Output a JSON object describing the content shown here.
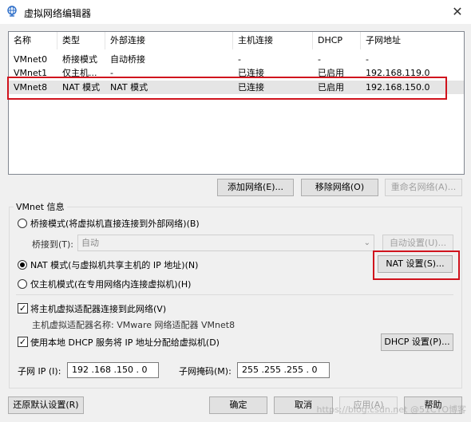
{
  "window": {
    "title": "虚拟网络编辑器",
    "close_glyph": "✕"
  },
  "table": {
    "headers": [
      "名称",
      "类型",
      "外部连接",
      "主机连接",
      "DHCP",
      "子网地址"
    ],
    "rows": [
      [
        "VMnet0",
        "桥接模式",
        "自动桥接",
        "-",
        "-",
        "-"
      ],
      [
        "VMnet1",
        "仅主机...",
        "-",
        "已连接",
        "已启用",
        "192.168.119.0"
      ],
      [
        "VMnet8",
        "NAT 模式",
        "NAT 模式",
        "已连接",
        "已启用",
        "192.168.150.0"
      ]
    ],
    "selected_row": 2
  },
  "buttons": {
    "add_network": "添加网络(E)...",
    "remove_network": "移除网络(O)",
    "rename_network": "重命名网络(A)...",
    "auto_settings": "自动设置(U)...",
    "nat_settings": "NAT 设置(S)...",
    "dhcp_settings": "DHCP 设置(P)...",
    "restore_defaults": "还原默认设置(R)",
    "ok": "确定",
    "cancel": "取消",
    "apply": "应用(A)",
    "help": "帮助"
  },
  "vmnet_info": {
    "group_label": "VMnet 信息",
    "bridged_radio": "桥接模式(将虚拟机直接连接到外部网络)(B)",
    "bridged_to_label": "桥接到(T):",
    "bridged_to_value": "自动",
    "nat_radio": "NAT 模式(与虚拟机共享主机的 IP 地址)(N)",
    "hostonly_radio": "仅主机模式(在专用网络内连接虚拟机)(H)",
    "selected_mode": "nat",
    "connect_adapter_check": "将主机虚拟适配器连接到此网络(V)",
    "connect_adapter_checked": true,
    "adapter_name_text": "主机虚拟适配器名称: VMware 网络适配器 VMnet8",
    "use_dhcp_check": "使用本地 DHCP 服务将 IP 地址分配给虚拟机(D)",
    "use_dhcp_checked": true,
    "subnet_ip_label": "子网 IP (I):",
    "subnet_ip_value": "192 .168 .150 . 0",
    "subnet_mask_label": "子网掩码(M):",
    "subnet_mask_value": "255 .255 .255 . 0"
  },
  "watermark": "https://blog.csdn.net @51CTO博客",
  "colors": {
    "highlight_box": "#d0131d",
    "selection": "#e5e5e5"
  }
}
